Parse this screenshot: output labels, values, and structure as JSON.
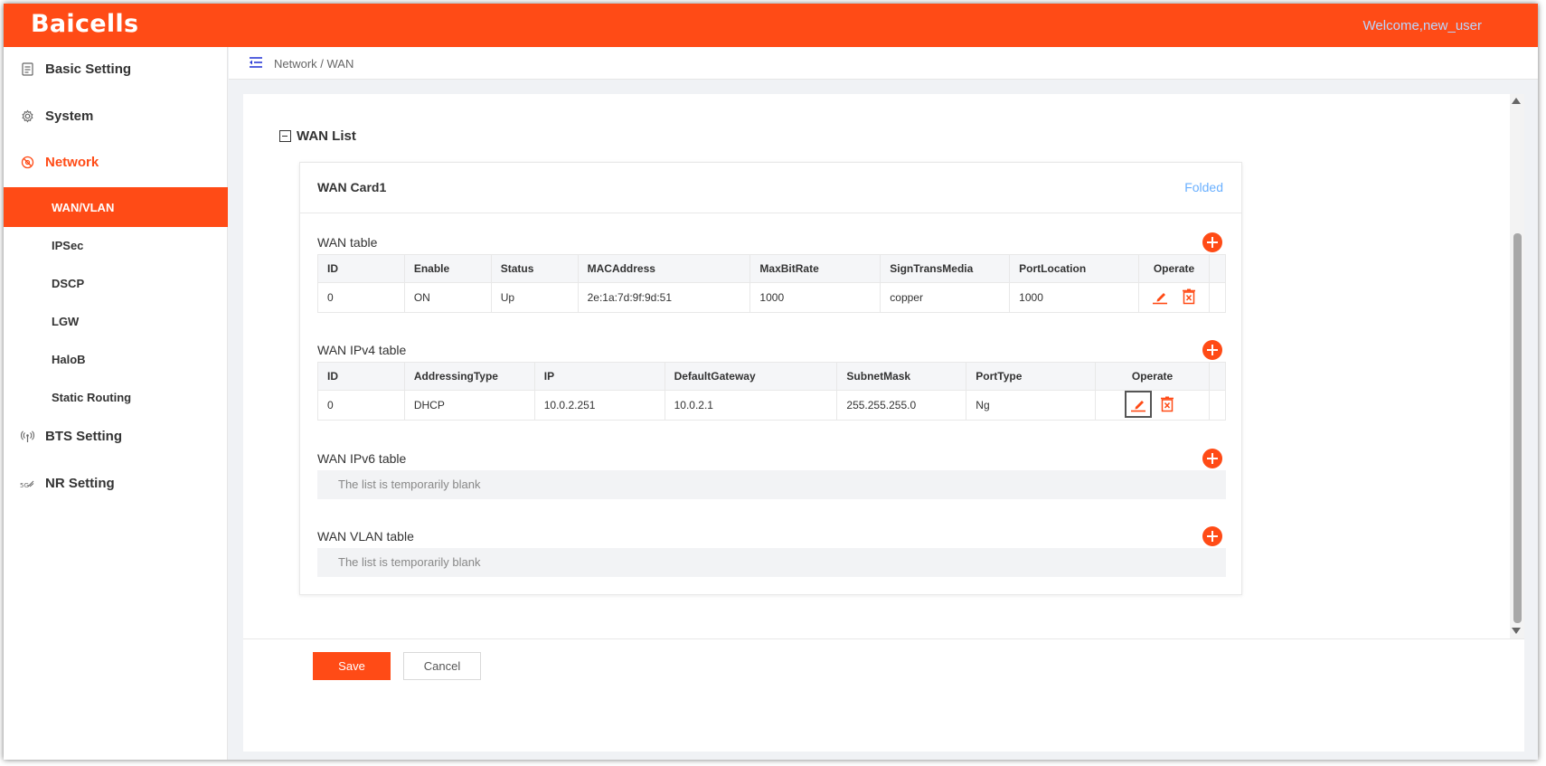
{
  "header": {
    "logo_text": "Baicells",
    "welcome_text": "Welcome,new_user"
  },
  "sidebar": {
    "items": [
      {
        "label": "Basic Setting",
        "icon": "document-icon"
      },
      {
        "label": "System",
        "icon": "gear-icon"
      },
      {
        "label": "Network",
        "icon": "network-icon"
      },
      {
        "label": "BTS Setting",
        "icon": "antenna-icon"
      },
      {
        "label": "NR Setting",
        "icon": "5g-icon"
      }
    ],
    "network_sub": [
      "WAN/VLAN",
      "IPSec",
      "DSCP",
      "LGW",
      "HaloB",
      "Static Routing"
    ]
  },
  "breadcrumb": {
    "text": "Network / WAN"
  },
  "section": {
    "title": "WAN List"
  },
  "card": {
    "title": "WAN Card1",
    "fold_label": "Folded"
  },
  "wan_table": {
    "label": "WAN table",
    "columns": [
      "ID",
      "Enable",
      "Status",
      "MACAddress",
      "MaxBitRate",
      "SignTransMedia",
      "PortLocation",
      "Operate"
    ],
    "rows": [
      [
        "0",
        "ON",
        "Up",
        "2e:1a:7d:9f:9d:51",
        "1000",
        "copper",
        "1000"
      ]
    ]
  },
  "ipv4_table": {
    "label": "WAN IPv4 table",
    "columns": [
      "ID",
      "AddressingType",
      "IP",
      "DefaultGateway",
      "SubnetMask",
      "PortType",
      "Operate"
    ],
    "rows": [
      [
        "0",
        "DHCP",
        "10.0.2.251",
        "10.0.2.1",
        "255.255.255.0",
        "Ng"
      ]
    ]
  },
  "ipv6_table": {
    "label": "WAN IPv6 table",
    "empty_text": "The list is temporarily blank"
  },
  "vlan_table": {
    "label": "WAN VLAN table",
    "empty_text": "The list is temporarily blank"
  },
  "footer": {
    "save_label": "Save",
    "cancel_label": "Cancel"
  },
  "colors": {
    "brand": "#ff4b16",
    "link": "#6ab0ff",
    "welcome": "#b9d6ff"
  }
}
